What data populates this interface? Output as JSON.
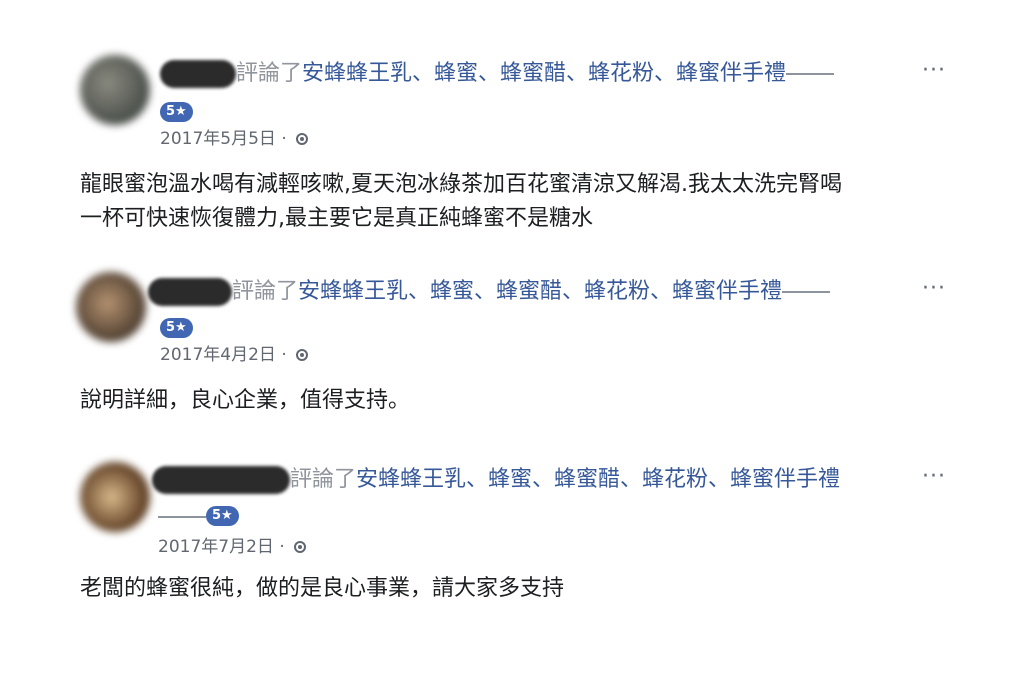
{
  "colors": {
    "link": "#365899",
    "muted": "#90949c",
    "badge": "#4267b2"
  },
  "reviews": [
    {
      "verb": "評論了",
      "page": "安蜂蜂王乳、蜂蜜、蜂蜜醋、蜂花粉、蜂蜜伴手禮",
      "rating": "5★",
      "date": "2017年5月5日",
      "separator": "·",
      "more": "···",
      "text_line1": "龍眼蜜泡溫水喝有減輕咳嗽,夏天泡冰綠茶加百花蜜清涼又解渴.我太太洗完腎喝",
      "text_line2": "一杯可快速恢復體力,最主要它是真正純蜂蜜不是糖水"
    },
    {
      "verb": "評論了",
      "page": "安蜂蜂王乳、蜂蜜、蜂蜜醋、蜂花粉、蜂蜜伴手禮",
      "rating": "5★",
      "date": "2017年4月2日",
      "separator": "·",
      "more": "···",
      "text_line1": "說明詳細，良心企業，值得支持。"
    },
    {
      "verb": "評論了",
      "page": "安蜂蜂王乳、蜂蜜、蜂蜜醋、蜂花粉、蜂蜜伴手禮",
      "rating": "5★",
      "date": "2017年7月2日",
      "separator": "·",
      "more": "···",
      "text_line1": "老闆的蜂蜜很純，做的是良心事業，請大家多支持"
    }
  ]
}
